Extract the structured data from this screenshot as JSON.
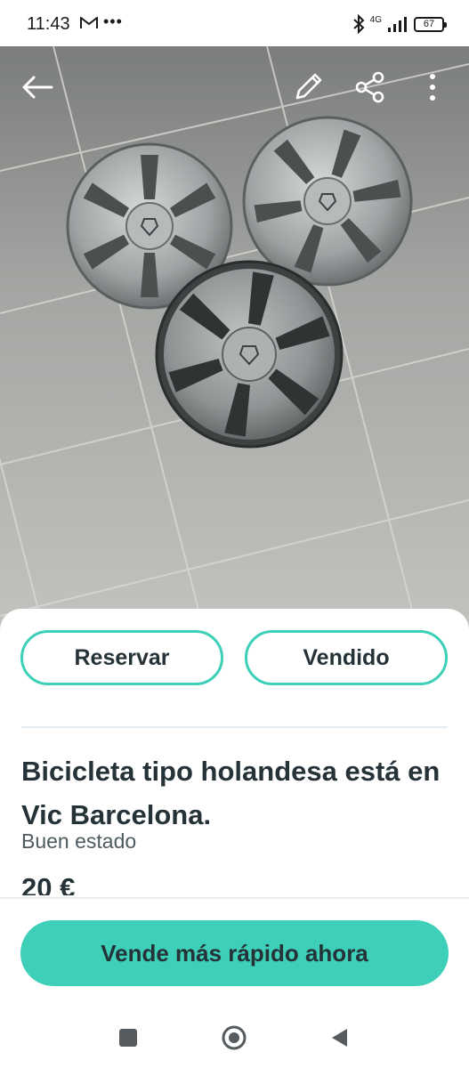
{
  "status_bar": {
    "time": "11:43",
    "network": "4G",
    "battery": "67"
  },
  "photo": {
    "icons": [
      "back-arrow-icon",
      "edit-pencil-icon",
      "share-icon",
      "more-vert-icon"
    ]
  },
  "actions": {
    "reserve_label": "Reservar",
    "sold_label": "Vendido"
  },
  "listing": {
    "title": "Bicicleta tipo holandesa está en Vic Barcelona.",
    "condition": "Buen estado",
    "price": "20 €"
  },
  "cta": {
    "label": "Vende más rápido ahora"
  },
  "colors": {
    "accent": "#3dcfb7",
    "text": "#253238"
  },
  "nav": {
    "icons": [
      "recents-square-icon",
      "home-circle-icon",
      "back-triangle-icon"
    ]
  }
}
